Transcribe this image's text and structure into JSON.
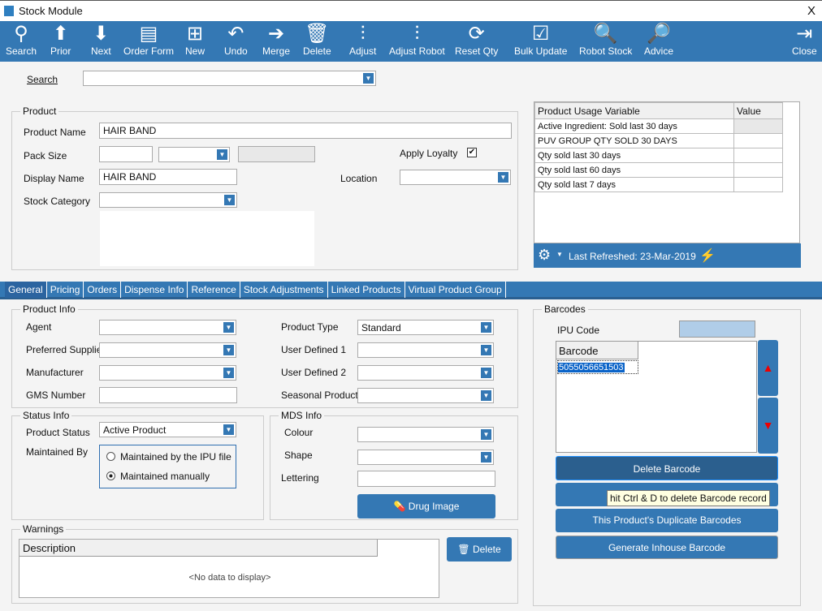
{
  "window": {
    "title": "Stock Module",
    "close": "X"
  },
  "toolbar": [
    {
      "label": "Search",
      "icon": "search-icon",
      "glyph": "⚲"
    },
    {
      "label": "Prior",
      "icon": "arrow-up-circle-icon",
      "glyph": "⬆"
    },
    {
      "label": "Next",
      "icon": "arrow-down-circle-icon",
      "glyph": "⬇"
    },
    {
      "label": "Order Form",
      "icon": "document-list-icon",
      "glyph": "▤"
    },
    {
      "label": "New",
      "icon": "new-document-icon",
      "glyph": "⊞"
    },
    {
      "label": "Undo",
      "icon": "undo-icon",
      "glyph": "↶"
    },
    {
      "label": "Merge",
      "icon": "merge-icon",
      "glyph": "➔"
    },
    {
      "label": "Delete",
      "icon": "trash-icon",
      "glyph": "🗑"
    },
    {
      "label": "Adjust",
      "icon": "sliders-icon",
      "glyph": "⫶"
    },
    {
      "label": "Adjust Robot",
      "icon": "sliders-robot-icon",
      "glyph": "⫶"
    },
    {
      "label": "Reset Qty",
      "icon": "refresh-icon",
      "glyph": "⟳"
    },
    {
      "label": "Bulk Update",
      "icon": "checklist-icon",
      "glyph": "☑"
    },
    {
      "label": "Robot Stock",
      "icon": "document-search-icon",
      "glyph": "🔍"
    },
    {
      "label": "Advice",
      "icon": "folder-search-icon",
      "glyph": "🔎"
    },
    {
      "label": "Close",
      "icon": "exit-icon",
      "glyph": "⇥"
    }
  ],
  "search": {
    "label": "Search",
    "value": ""
  },
  "product": {
    "title": "Product",
    "name_label": "Product Name",
    "name": "HAIR BAND",
    "pack_label": "Pack Size",
    "display_label": "Display Name",
    "display": "HAIR BAND",
    "category_label": "Stock Category",
    "loyalty_label": "Apply Loyalty",
    "loyalty_checked": true,
    "location_label": "Location"
  },
  "puv": {
    "headers": [
      "Product Usage Variable",
      "Value"
    ],
    "rows": [
      "Active Ingredient: Sold last 30 days",
      "PUV GROUP QTY SOLD 30 DAYS",
      "Qty sold last 30 days",
      "Qty sold last 60 days",
      "Qty sold last 7 days"
    ],
    "refreshed": "Last Refreshed: 23-Mar-2019"
  },
  "tabs": [
    "General",
    "Pricing",
    "Orders",
    "Dispense Info",
    "Reference",
    "Stock Adjustments",
    "Linked Products",
    "Virtual Product Group"
  ],
  "info": {
    "title": "Product Info",
    "agent": "Agent",
    "supplier": "Preferred Supplier",
    "manufacturer": "Manufacturer",
    "gms": "GMS Number",
    "type_label": "Product Type",
    "type": "Standard",
    "ud1": "User Defined 1",
    "ud2": "User Defined 2",
    "seasonal": "Seasonal Products"
  },
  "status": {
    "title": "Status Info",
    "status_label": "Product Status",
    "status": "Active Product",
    "maintained_label": "Maintained By",
    "opt1": "Maintained by the IPU file",
    "opt2": "Maintained manually",
    "selected": "Maintained manually"
  },
  "mds": {
    "title": "MDS Info",
    "colour": "Colour",
    "shape": "Shape",
    "lettering": "Lettering",
    "drug_image": "Drug Image"
  },
  "warnings": {
    "title": "Warnings",
    "header": "Description",
    "empty": "<No data to display>",
    "delete": "Delete"
  },
  "barcodes": {
    "title": "Barcodes",
    "ipu_label": "IPU Code",
    "header": "Barcode",
    "values": [
      "5055056651503"
    ],
    "delete": "Delete Barcode",
    "tooltip": "hit Ctrl & D to delete Barcode record",
    "duplicates": "This Product's Duplicate Barcodes",
    "generate": "Generate Inhouse Barcode"
  }
}
